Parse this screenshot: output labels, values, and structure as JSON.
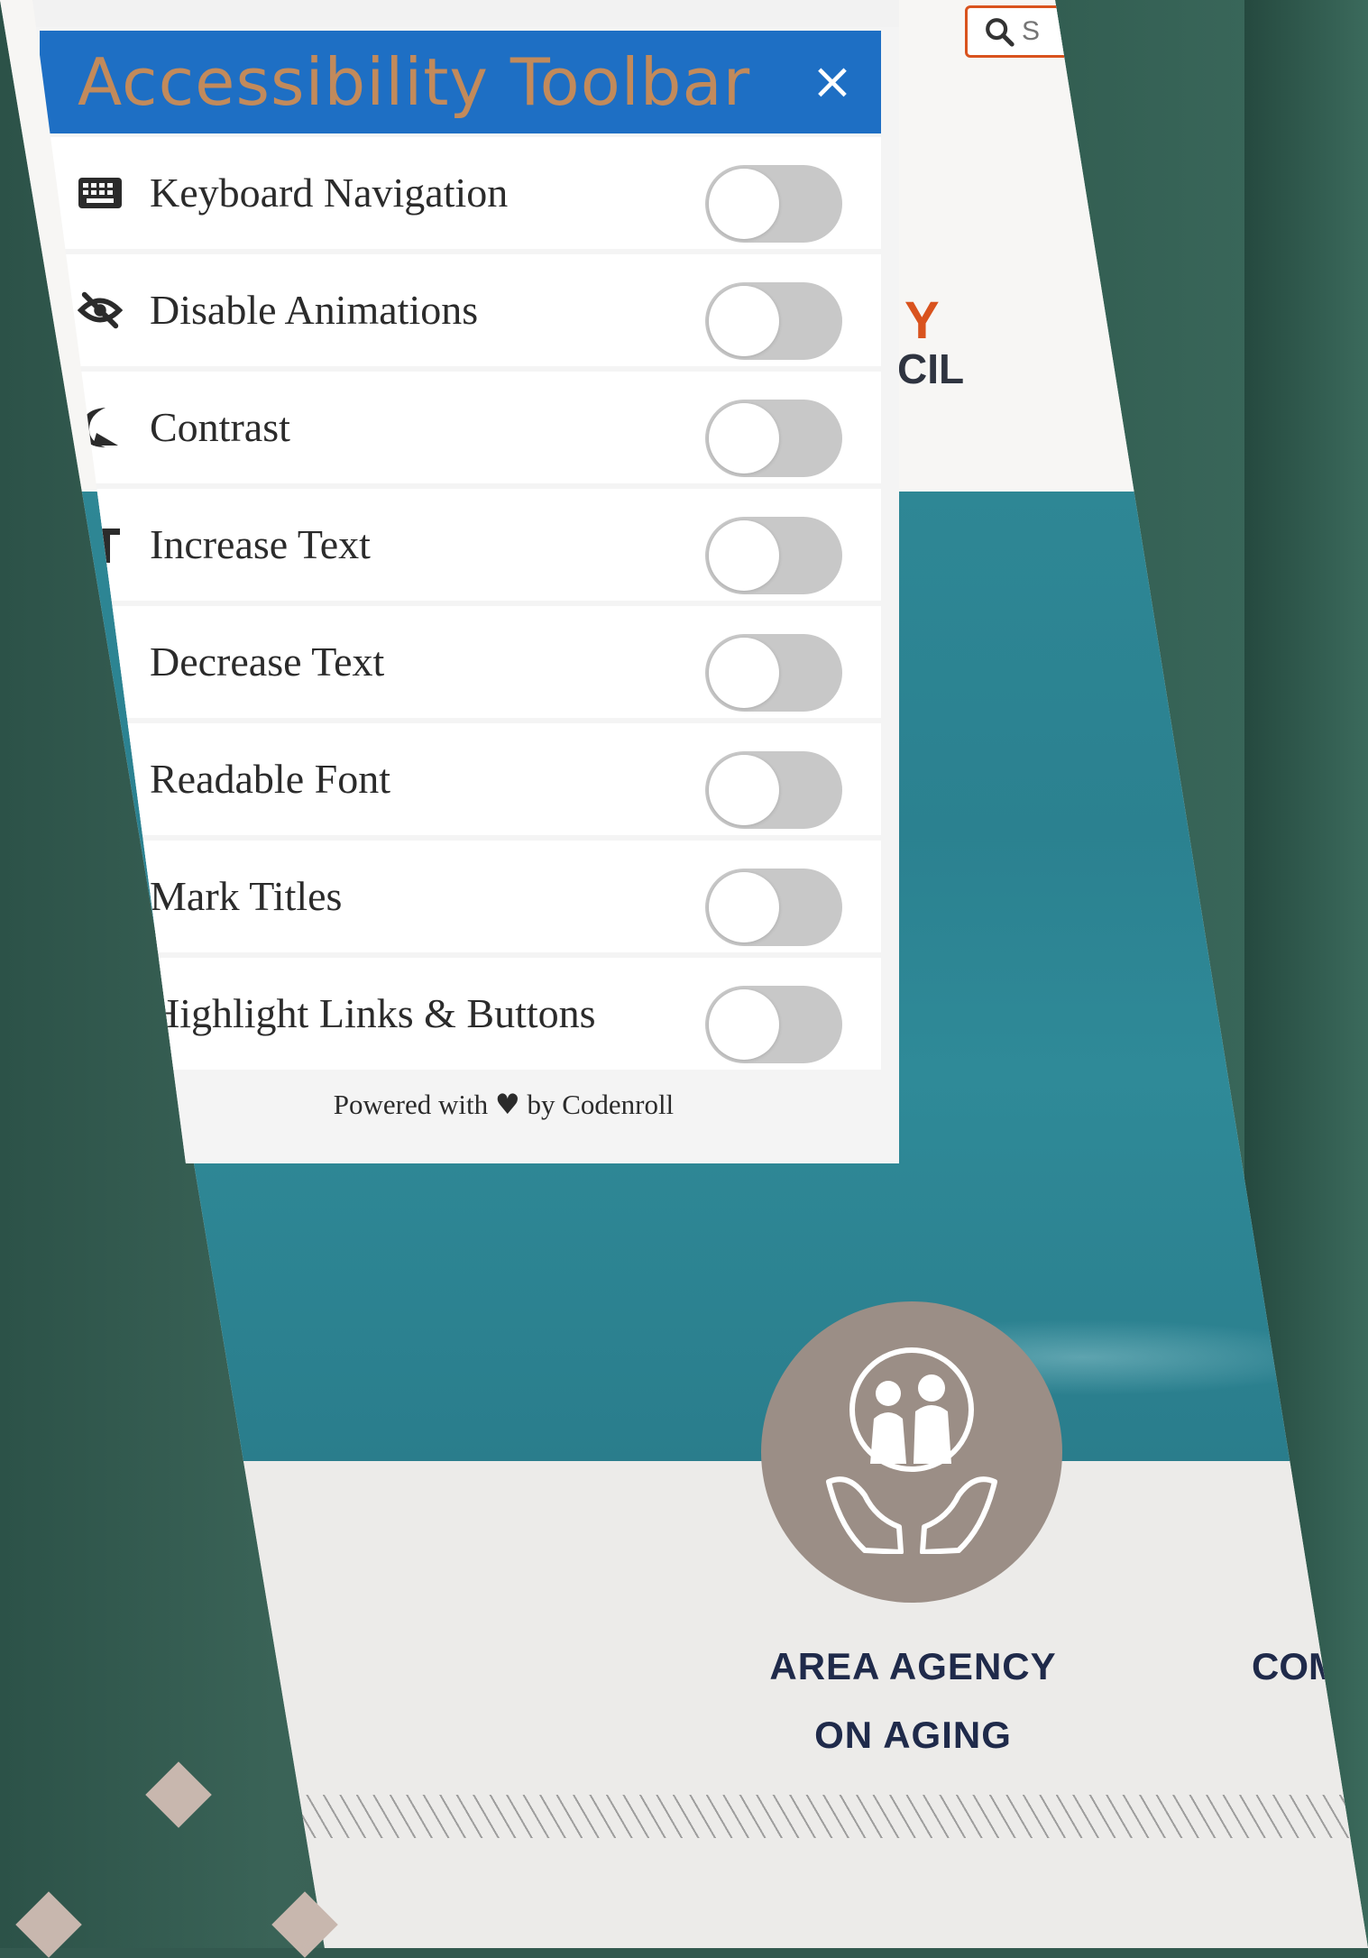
{
  "toolbar": {
    "title": "Accessibility Toolbar",
    "close_label": "×",
    "items": [
      {
        "label": "Keyboard Navigation",
        "icon": "keyboard-icon",
        "enabled": false
      },
      {
        "label": "Disable Animations",
        "icon": "eye-slash-icon",
        "enabled": false
      },
      {
        "label": "Contrast",
        "icon": "contrast-icon",
        "enabled": false
      },
      {
        "label": "Increase Text",
        "icon": "increase-text-icon",
        "enabled": false
      },
      {
        "label": "Decrease Text",
        "icon": "decrease-text-icon",
        "enabled": false
      },
      {
        "label": "Readable Font",
        "icon": "font-icon",
        "enabled": false
      },
      {
        "label": "Mark Titles",
        "icon": "title-icon",
        "enabled": false
      },
      {
        "label": "Highlight Links & Buttons",
        "icon": "link-icon",
        "enabled": false
      }
    ],
    "footer_prefix": "Powered with",
    "footer_heart": "♥",
    "footer_suffix": "by Codenroll"
  },
  "site": {
    "search_placeholder": "S",
    "org_name_fragment_1": "Y",
    "org_name_fragment_2": "CIL",
    "services": [
      {
        "line1": "AREA AGENCY",
        "line2": "ON AGING"
      },
      {
        "line1": "COM"
      }
    ]
  },
  "colors": {
    "toolbar_header": "#1e6fc4",
    "toolbar_title": "#c28a5b",
    "accent_orange": "#d9531e",
    "background": "#33594f",
    "hero_water": "#2e8795",
    "service_circle": "#9b8e86"
  }
}
